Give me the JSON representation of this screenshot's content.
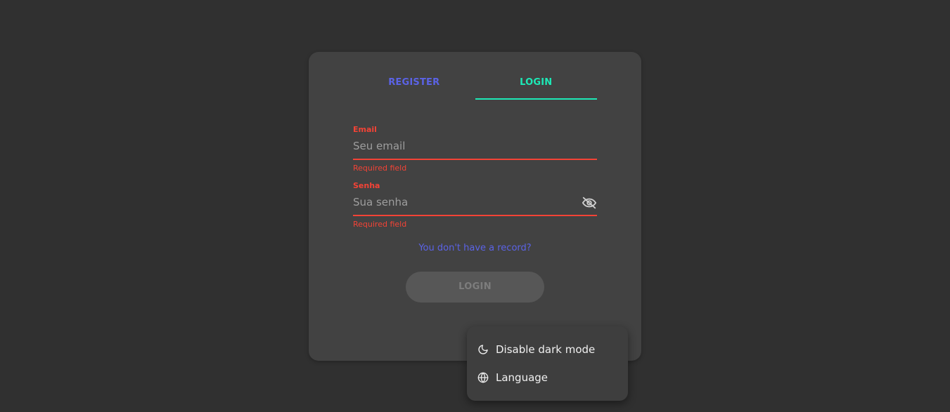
{
  "tabs": {
    "register": "REGISTER",
    "login": "LOGIN"
  },
  "form": {
    "email": {
      "label": "Email",
      "placeholder": "Seu email",
      "error": "Required field"
    },
    "password": {
      "label": "Senha",
      "placeholder": "Sua senha",
      "error": "Required field",
      "toggle_icon": "eye-off-icon"
    },
    "no_record_link": "You don't have a record?",
    "submit_label": "LOGIN"
  },
  "menu": {
    "items": [
      {
        "label": "Disable dark mode",
        "icon": "moon-icon"
      },
      {
        "label": "Language",
        "icon": "globe-icon"
      }
    ]
  },
  "colors": {
    "background": "#303030",
    "card": "#424242",
    "accent_tab": "#1de9b6",
    "link": "#5b63e6",
    "error": "#f44336"
  }
}
